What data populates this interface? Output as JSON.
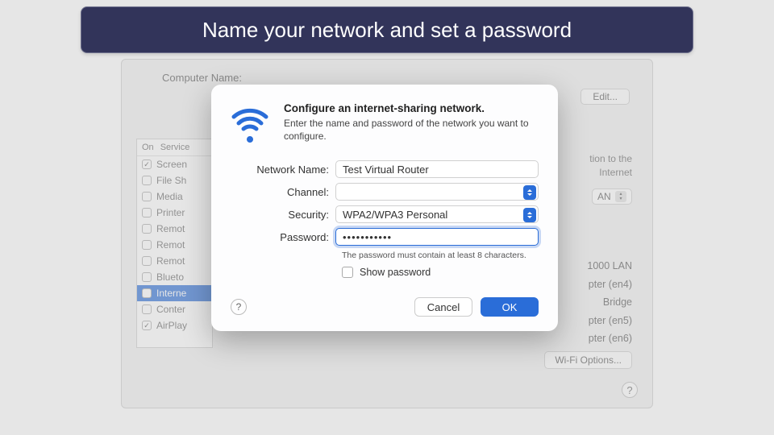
{
  "banner": {
    "text": "Name your network and set a password"
  },
  "prefs": {
    "computer_name_label": "Computer Name:",
    "computer_name_value": "",
    "edit_label": "Edit...",
    "services_header_on": "On",
    "services_header_service": "Service",
    "services": [
      {
        "label": "Screen",
        "checked": true,
        "selected": false
      },
      {
        "label": "File Sh",
        "checked": false,
        "selected": false
      },
      {
        "label": "Media",
        "checked": false,
        "selected": false
      },
      {
        "label": "Printer",
        "checked": false,
        "selected": false
      },
      {
        "label": "Remot",
        "checked": false,
        "selected": false
      },
      {
        "label": "Remot",
        "checked": false,
        "selected": false
      },
      {
        "label": "Remot",
        "checked": false,
        "selected": false
      },
      {
        "label": "Blueto",
        "checked": false,
        "selected": false
      },
      {
        "label": "Interne",
        "checked": false,
        "selected": true
      },
      {
        "label": "Conter",
        "checked": false,
        "selected": false
      },
      {
        "label": "AirPlay",
        "checked": true,
        "selected": false
      }
    ],
    "right_info_1": "tion to the",
    "right_info_2": "Internet",
    "lan_select": "AN",
    "right_list": [
      "1000 LAN",
      "pter (en4)",
      "Bridge",
      "pter (en5)",
      "pter (en6)"
    ],
    "wifi_options_label": "Wi-Fi Options...",
    "help_symbol": "?"
  },
  "dialog": {
    "title": "Configure an internet-sharing network.",
    "subtitle": "Enter the name and password of the network you want to configure.",
    "labels": {
      "network_name": "Network Name:",
      "channel": "Channel:",
      "security": "Security:",
      "password": "Password:"
    },
    "values": {
      "network_name": "Test Virtual Router",
      "channel": "",
      "security": "WPA2/WPA3 Personal",
      "password_mask": "•••••••••••"
    },
    "password_hint": "The password must contain at least 8 characters.",
    "show_password_label": "Show password",
    "cancel_label": "Cancel",
    "ok_label": "OK",
    "help_symbol": "?"
  }
}
